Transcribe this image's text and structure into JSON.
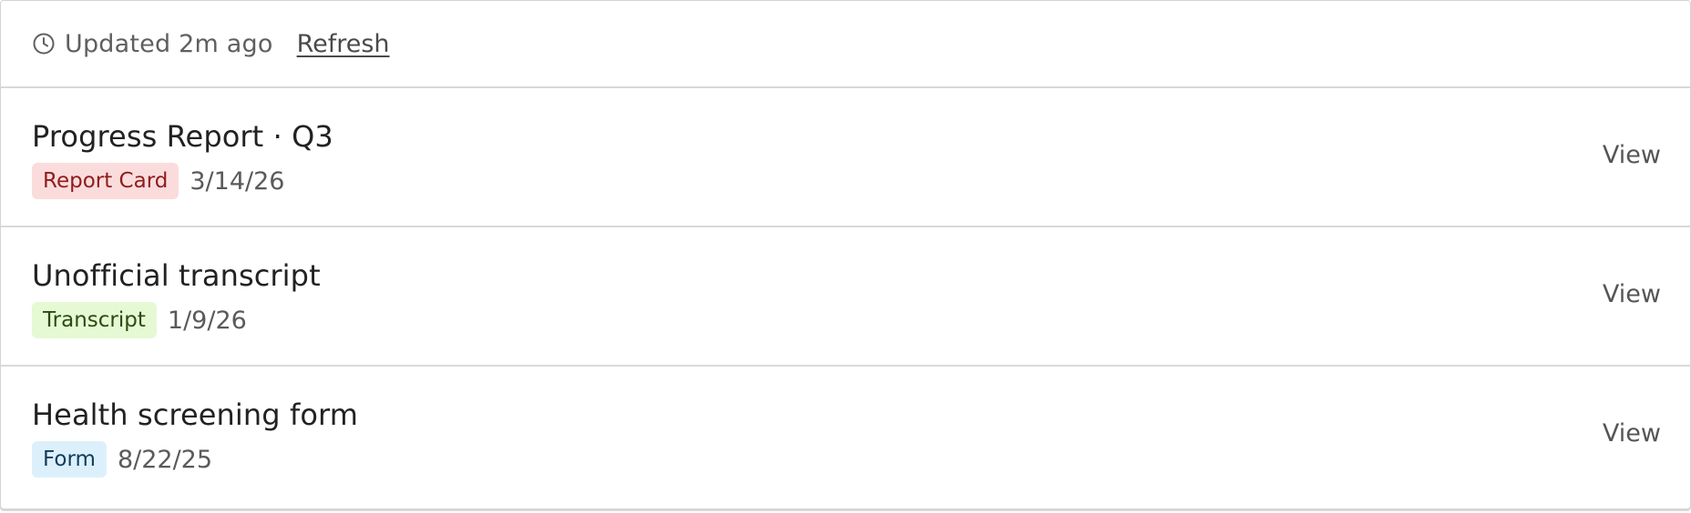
{
  "header": {
    "updated_text": "Updated 2m ago",
    "refresh_label": "Refresh",
    "clock_icon": "clock-icon"
  },
  "documents": [
    {
      "title": "Progress Report · Q3",
      "badge": "Report Card",
      "badge_color": "#fbdcdc",
      "date": "3/14/26",
      "action": "View"
    },
    {
      "title": "Unofficial transcript",
      "badge": "Transcript",
      "badge_color": "#e5f9d4",
      "date": "1/9/26",
      "action": "View"
    },
    {
      "title": "Health screening form",
      "badge": "Form",
      "badge_color": "#dcf0fb",
      "date": "8/22/25",
      "action": "View"
    }
  ]
}
